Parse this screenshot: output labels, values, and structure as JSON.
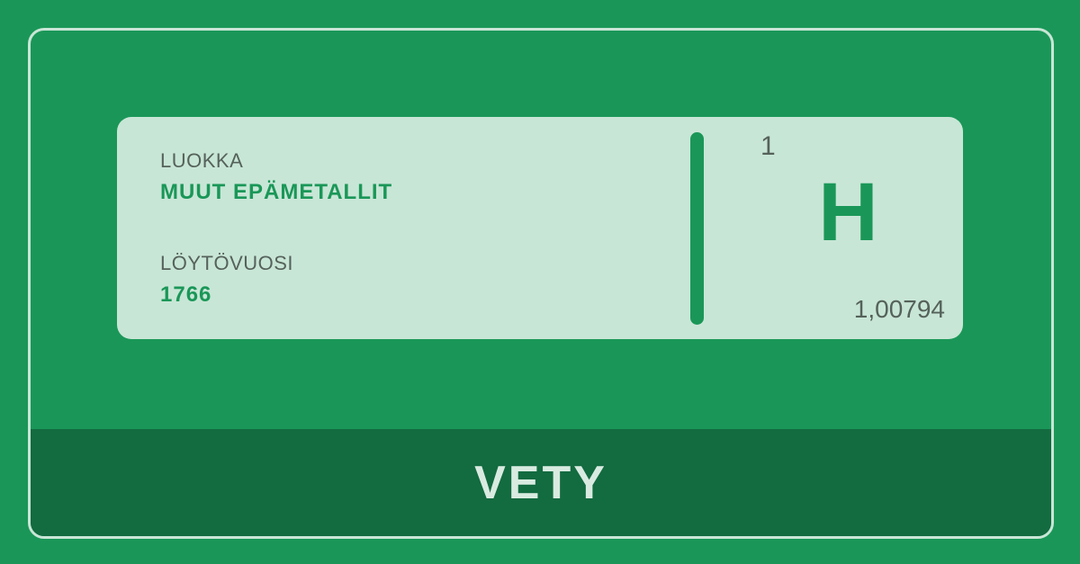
{
  "card": {
    "category_label": "LUOKKA",
    "category_value": "MUUT EPÄMETALLIT",
    "discovery_label": "LÖYTÖVUOSI",
    "discovery_value": "1766",
    "atomic_number": "1",
    "symbol": "H",
    "atomic_mass": "1,00794"
  },
  "footer": {
    "element_name": "VETY"
  },
  "colors": {
    "background": "#1a9758",
    "card": "#c8e6d6",
    "footer": "#136b40",
    "accent": "#1a9758",
    "label_text": "#55625b"
  }
}
